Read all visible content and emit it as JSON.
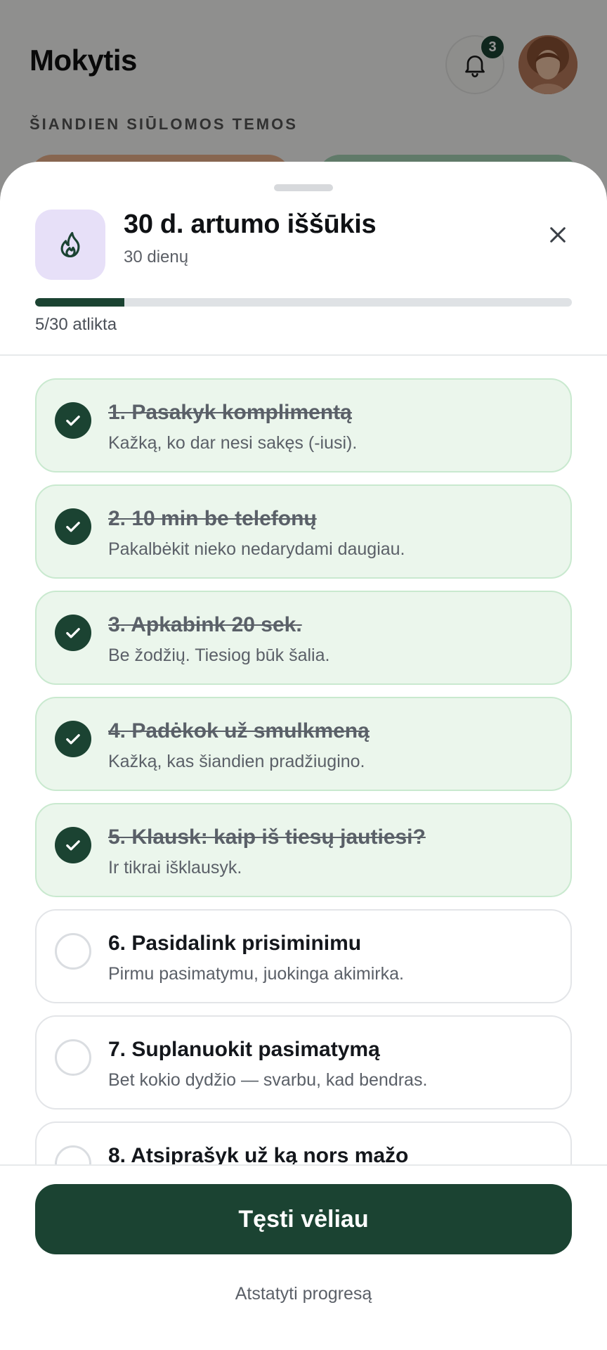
{
  "background": {
    "title": "Mokytis",
    "notification_count": "3",
    "section_label": "ŠIANDIEN SIŪLOMOS TEMOS"
  },
  "sheet": {
    "title": "30 d. artumo iššūkis",
    "subtitle": "30 dienų",
    "progress": {
      "completed": 5,
      "total": 30,
      "fraction": 0.1667
    },
    "progress_label": "5/30 atlikta",
    "items": [
      {
        "title": "1. Pasakyk komplimentą",
        "desc": "Kažką, ko dar nesi sakęs (-iusi).",
        "done": true
      },
      {
        "title": "2. 10 min be telefonų",
        "desc": "Pakalbėkit nieko nedarydami daugiau.",
        "done": true
      },
      {
        "title": "3. Apkabink 20 sek.",
        "desc": "Be žodžių. Tiesiog būk šalia.",
        "done": true
      },
      {
        "title": "4. Padėkok už smulkmeną",
        "desc": "Kažką, kas šiandien pradžiugino.",
        "done": true
      },
      {
        "title": "5. Klausk: kaip iš tiesų jautiesi?",
        "desc": "Ir tikrai išklausyk.",
        "done": true
      },
      {
        "title": "6. Pasidalink prisiminimu",
        "desc": "Pirmu pasimatymu, juokinga akimirka.",
        "done": false
      },
      {
        "title": "7. Suplanuokit pasimatymą",
        "desc": "Bet kokio dydžio — svarbu, kad bendras.",
        "done": false
      },
      {
        "title": "8. Atsiprašyk už ką nors mažo",
        "desc": "",
        "done": false
      }
    ],
    "primary_button": "Tęsti vėliau",
    "reset_link": "Atstatyti progresą"
  },
  "colors": {
    "accent": "#1b4332",
    "done_bg": "#ebf6ec",
    "icon_bg": "#e7e0f8"
  }
}
